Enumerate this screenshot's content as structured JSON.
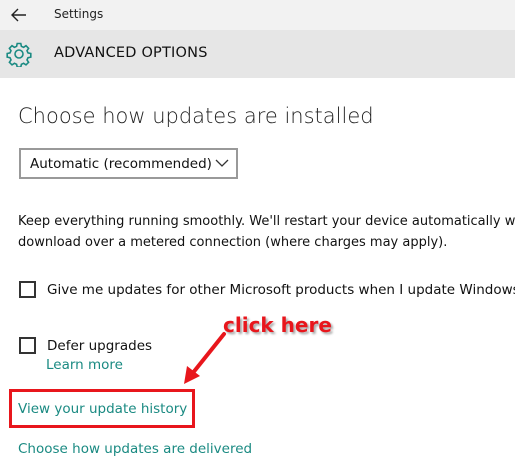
{
  "window": {
    "title": "Settings"
  },
  "header": {
    "title": "ADVANCED OPTIONS"
  },
  "updates": {
    "section_title": "Choose how updates are installed",
    "install_mode": {
      "selected": "Automatic (recommended)"
    },
    "description_line1": "Keep everything running smoothly. We'll restart your device automatically w",
    "description_line2": "download over a metered connection (where charges may apply).",
    "other_products_checkbox": {
      "label": "Give me updates for other Microsoft products when I update Windows.",
      "checked": false
    },
    "defer_upgrades_checkbox": {
      "label": "Defer upgrades",
      "checked": false
    },
    "learn_more_link": "Learn more",
    "update_history_link": "View your update history",
    "delivery_link": "Choose how updates are delivered"
  },
  "annotation": {
    "text": "click here",
    "color": "#e8161c"
  },
  "colors": {
    "link": "#1a8a82",
    "header_bg": "#e6e6e6",
    "titlebar_bg": "#f2f2f2",
    "accent_icon": "#1a8a82"
  },
  "icons": {
    "back": "back-arrow-icon",
    "settings": "gear-icon",
    "dropdown": "chevron-down-icon"
  }
}
